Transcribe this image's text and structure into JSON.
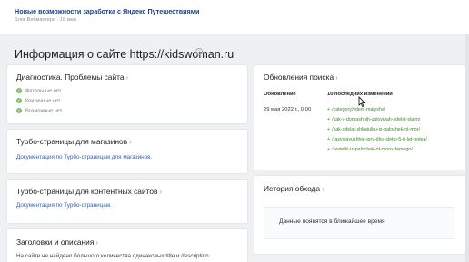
{
  "notice": {
    "title": "Новые возможности заработка с Яндекс Путешествиями",
    "meta": "Блог Вебмастера · 16 мая"
  },
  "page": {
    "title": "Информация о сайте https://kidswoman.ru",
    "info_icon": "i"
  },
  "diagnostics": {
    "title": "Диагностика. Проблемы сайта",
    "rows": [
      "Фатальные нет",
      "Критичные нет",
      "Возможные нет"
    ]
  },
  "turbo_shops": {
    "title": "Турбо-страницы для магазинов",
    "link": "Документация по Турбо-страницам для магазинов."
  },
  "turbo_content": {
    "title": "Турбо-страницы для контентных сайтов",
    "link": "Документация по Турбо-страницам."
  },
  "headings": {
    "title": "Заголовки и описания",
    "text": "На сайте не найдено большого количества одинаковых title и description."
  },
  "search_updates": {
    "title": "Обновления поиска",
    "col_update": "Обновление",
    "col_changes": "10 последних изменений",
    "date": "29 мая 2022 г., 0:00",
    "changes": [
      "/category/vdem-malysha/",
      "/kak-v-domashnih-usloviyah-sdelat-slajm/",
      "/kak-sdelat-shkatulku-iz-palochek-ot-mor/",
      "/razvivayushhie-igry-dlya-detej-5-6-let-potea/",
      "/podelki-iz-palochek-ot-morozhenogo/"
    ]
  },
  "crawl_history": {
    "title": "История обхода",
    "empty": "Данные появятся в ближайшее время"
  },
  "colors": {
    "link": "#3465b4",
    "positive": "#3d8a2a",
    "check": "#7bbf6a"
  },
  "icons": {
    "check": "check-icon",
    "chevron": "chevron-right-icon",
    "info": "info-icon"
  }
}
